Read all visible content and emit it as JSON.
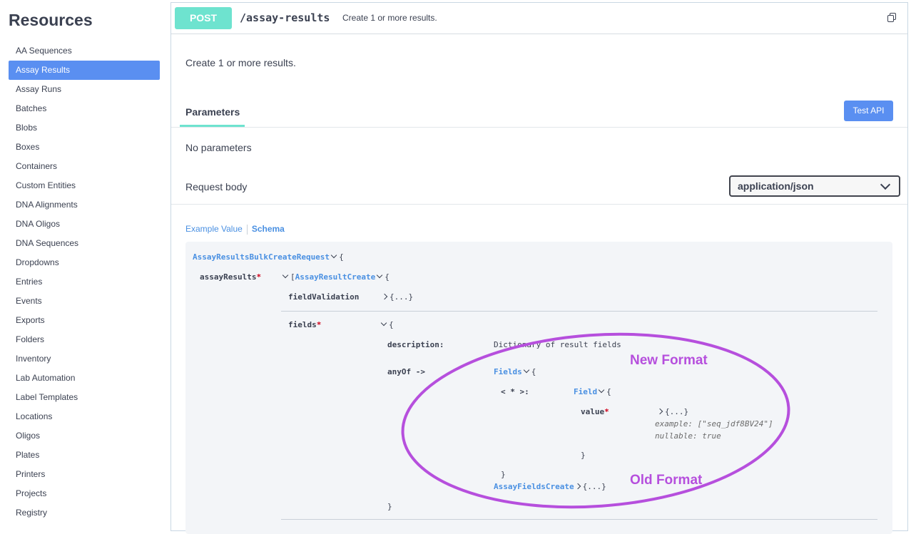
{
  "sidebar": {
    "title": "Resources",
    "items": [
      {
        "label": "AA Sequences",
        "active": false
      },
      {
        "label": "Assay Results",
        "active": true
      },
      {
        "label": "Assay Runs",
        "active": false
      },
      {
        "label": "Batches",
        "active": false
      },
      {
        "label": "Blobs",
        "active": false
      },
      {
        "label": "Boxes",
        "active": false
      },
      {
        "label": "Containers",
        "active": false
      },
      {
        "label": "Custom Entities",
        "active": false
      },
      {
        "label": "DNA Alignments",
        "active": false
      },
      {
        "label": "DNA Oligos",
        "active": false
      },
      {
        "label": "DNA Sequences",
        "active": false
      },
      {
        "label": "Dropdowns",
        "active": false
      },
      {
        "label": "Entries",
        "active": false
      },
      {
        "label": "Events",
        "active": false
      },
      {
        "label": "Exports",
        "active": false
      },
      {
        "label": "Folders",
        "active": false
      },
      {
        "label": "Inventory",
        "active": false
      },
      {
        "label": "Lab Automation",
        "active": false
      },
      {
        "label": "Label Templates",
        "active": false
      },
      {
        "label": "Locations",
        "active": false
      },
      {
        "label": "Oligos",
        "active": false
      },
      {
        "label": "Plates",
        "active": false
      },
      {
        "label": "Printers",
        "active": false
      },
      {
        "label": "Projects",
        "active": false
      },
      {
        "label": "Registry",
        "active": false
      }
    ]
  },
  "operation": {
    "method": "POST",
    "path": "/assay-results",
    "summary": "Create 1 or more results.",
    "description": "Create 1 or more results.",
    "copy_icon": "copy-icon"
  },
  "parameters": {
    "tab_label": "Parameters",
    "test_button": "Test API",
    "no_params": "No parameters"
  },
  "request_body": {
    "label": "Request body",
    "content_type": "application/json",
    "example_tab": "Example Value",
    "schema_tab": "Schema"
  },
  "schema": {
    "root": "AssayResultsBulkCreateRequest",
    "open_brace": "{",
    "assay_results_key": "assayResults",
    "required_mark": "*",
    "open_bracket": "[",
    "item_type": "AssayResultCreate",
    "field_validation_key": "fieldValidation",
    "collapsed": "{...}",
    "fields_key": "fields",
    "description_key": "description:",
    "description_value": "Dictionary of result fields",
    "anyof_key": "anyOf ->",
    "fields_type": "Fields",
    "additional_key": "< * >:",
    "field_type": "Field",
    "value_key": "value",
    "example_line": "example: [\"seq_jdf8BV24\"]",
    "nullable_line": "nullable: true",
    "close_brace": "}",
    "old_type": "AssayFieldsCreate"
  },
  "annotations": {
    "new_format": "New Format",
    "old_format": "Old Format",
    "color": "#b64fdd"
  },
  "colors": {
    "post": "#6ee3cf",
    "accent": "#5a8ff1",
    "link": "#4a90e2"
  }
}
